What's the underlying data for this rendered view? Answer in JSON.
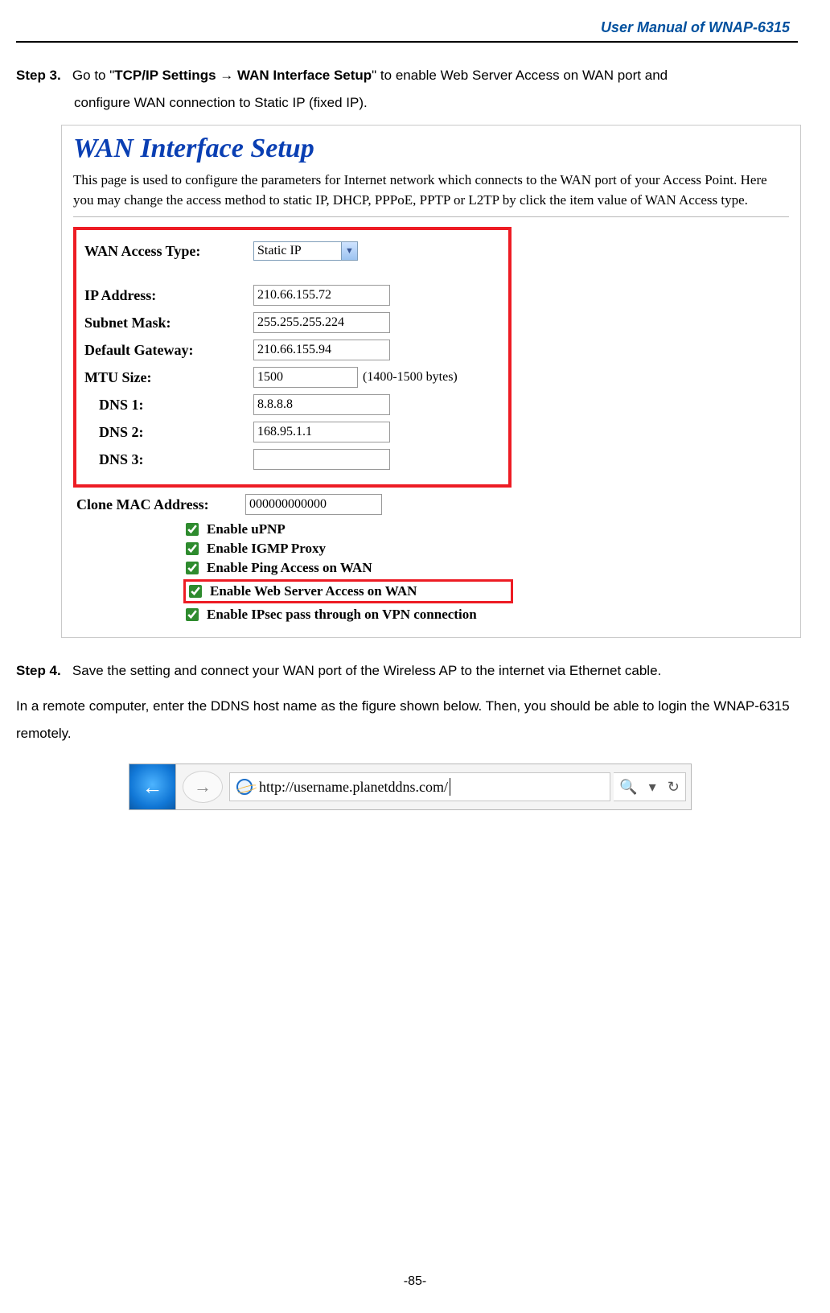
{
  "header": {
    "title": "User Manual of WNAP-6315"
  },
  "step3": {
    "label": "Step 3.",
    "pre": "Go to \"",
    "path": "TCP/IP Settings → WAN Interface Setup",
    "post": "\" to enable Web Server Access on WAN port and",
    "line2": "configure WAN connection to Static IP (fixed IP)."
  },
  "panel": {
    "title": "WAN Interface Setup",
    "desc": "This page is used to configure the parameters for Internet network which connects to the WAN port of your Access Point. Here you may change the access method to static IP, DHCP, PPPoE, PPTP or L2TP by click the item value of WAN Access type.",
    "labels": {
      "access": "WAN Access Type:",
      "ip": "IP Address:",
      "mask": "Subnet Mask:",
      "gw": "Default Gateway:",
      "mtu": "MTU Size:",
      "dns1": "DNS 1:",
      "dns2": "DNS 2:",
      "dns3": "DNS 3:",
      "clone": "Clone MAC Address:"
    },
    "values": {
      "access": "Static IP",
      "ip": "210.66.155.72",
      "mask": "255.255.255.224",
      "gw": "210.66.155.94",
      "mtu": "1500",
      "mtu_hint": "(1400-1500 bytes)",
      "dns1": "8.8.8.8",
      "dns2": "168.95.1.1",
      "dns3": "",
      "clone": "000000000000"
    },
    "checks": {
      "upnp": "Enable uPNP",
      "igmp": "Enable IGMP Proxy",
      "ping": "Enable Ping Access on WAN",
      "web": "Enable Web Server Access on WAN",
      "ipsec": "Enable IPsec pass through on VPN connection"
    }
  },
  "step4": {
    "label": "Step 4.",
    "text": "Save the setting and connect your WAN port of the Wireless AP to the internet via Ethernet cable."
  },
  "body2": "In a remote computer, enter the DDNS host name as the figure shown below. Then, you should be able to login the WNAP-6315 remotely.",
  "address_bar": {
    "url": "http://username.planetddns.com/"
  },
  "footer": "-85-"
}
